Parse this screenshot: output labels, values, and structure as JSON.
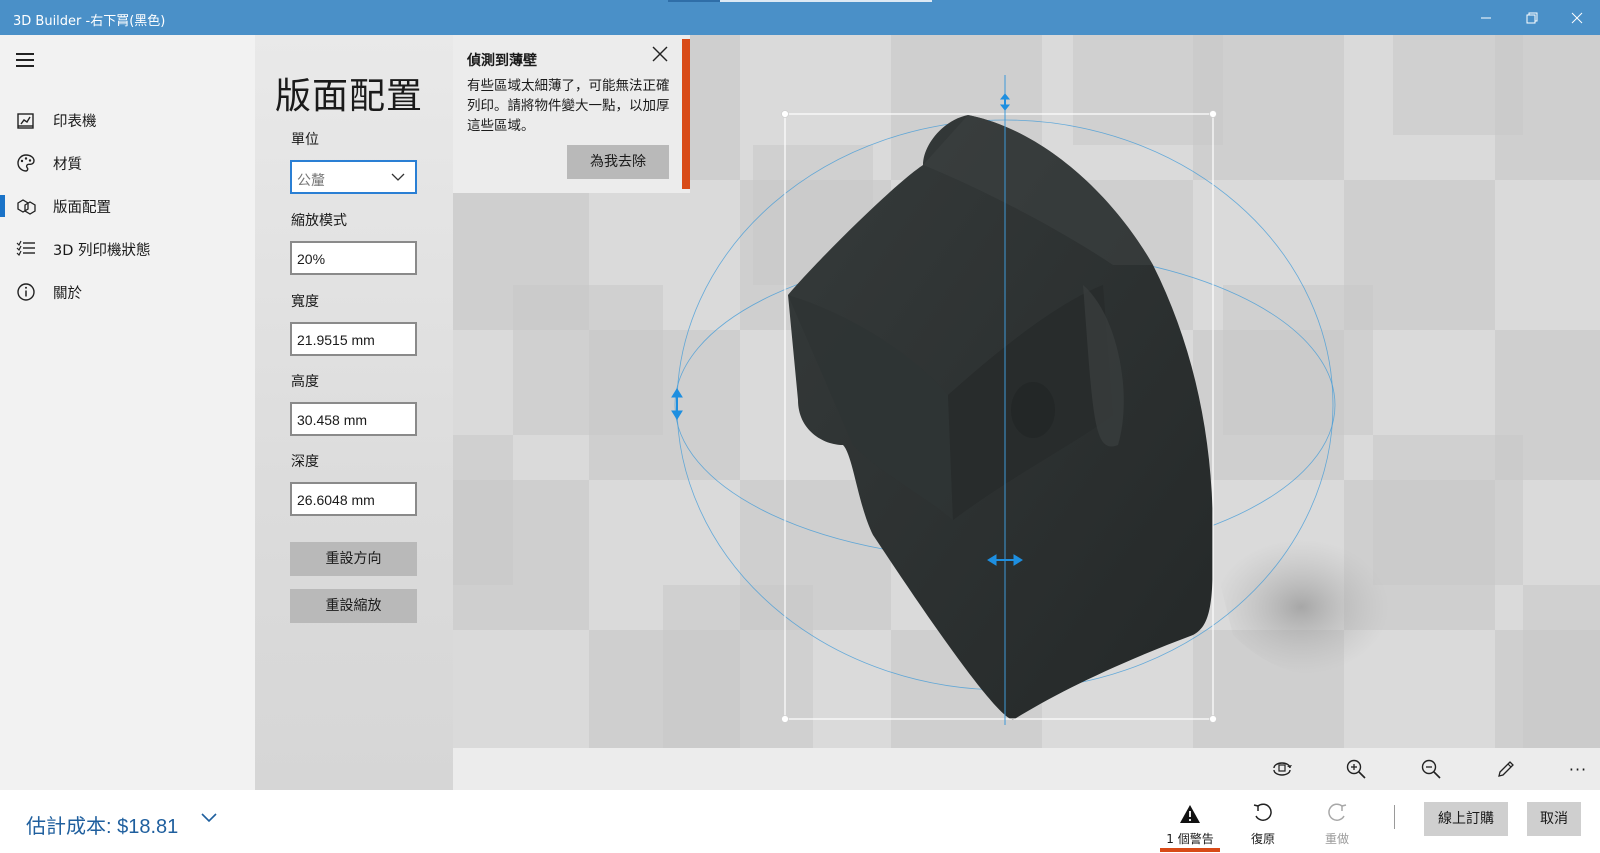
{
  "window": {
    "title": "3D Builder -右下罥(黑色)"
  },
  "sidebar": {
    "items": [
      {
        "label": "印表機",
        "icon": "printer-icon"
      },
      {
        "label": "材質",
        "icon": "palette-icon"
      },
      {
        "label": "版面配置",
        "icon": "layout-icon",
        "active": true
      },
      {
        "label": "3D 列印機狀態",
        "icon": "status-list-icon"
      },
      {
        "label": "關於",
        "icon": "info-icon"
      }
    ]
  },
  "panel": {
    "title": "版面配置",
    "unit_label": "單位",
    "unit_value": "公釐",
    "scale_mode_label": "縮放模式",
    "scale_value": "20%",
    "width_label": "寬度",
    "width_value": "21.9515 mm",
    "height_label": "高度",
    "height_value": "30.458 mm",
    "depth_label": "深度",
    "depth_value": "26.6048 mm",
    "reset_orientation": "重設方向",
    "reset_scale": "重設縮放"
  },
  "warning": {
    "title": "偵測到薄壁",
    "body": "有些區域太細薄了，可能無法正確列印。請將物件變大一點，以加厚這些區域。",
    "action": "為我去除"
  },
  "viewport_toolbar": {
    "icons": [
      "reset-view-icon",
      "zoom-in-icon",
      "zoom-out-icon",
      "pencil-icon",
      "more-icon"
    ],
    "more_label": "···"
  },
  "bottom": {
    "cost": "估計成本: $18.81",
    "warnings_label": "1 個警告",
    "undo_label": "復原",
    "redo_label": "重做",
    "order_online": "線上訂購",
    "cancel": "取消"
  },
  "colors": {
    "titlebar": "#4a90c8",
    "accent": "#1a73c8",
    "warning": "#d84a17",
    "model": "#2b2f2f",
    "cost_text": "#1f5f9e"
  }
}
